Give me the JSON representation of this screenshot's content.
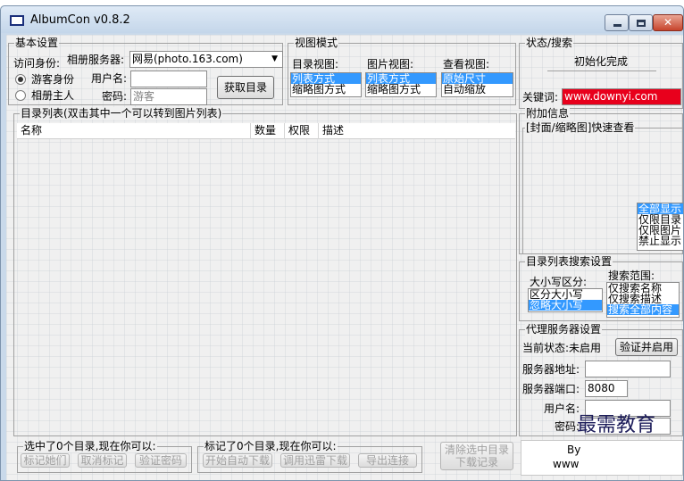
{
  "window": {
    "title": "AlbumCon v0.8.2",
    "close_glyph": "✕"
  },
  "basic": {
    "legend": "基本设置",
    "identity_label": "访问身份:",
    "guest_label": "游客身份",
    "owner_label": "相册主人",
    "server_label": "相册服务器:",
    "server_value": "网易(photo.163.com)",
    "username_label": "用户名:",
    "username_value": "",
    "password_label": "密码:",
    "password_value": "游客",
    "fetch_button": "获取目录"
  },
  "view": {
    "legend": "视图模式",
    "dir_label": "目录视图:",
    "dir_options": [
      "列表方式",
      "缩略图方式"
    ],
    "pic_label": "图片视图:",
    "pic_options": [
      "列表方式",
      "缩略图方式"
    ],
    "see_label": "查看视图:",
    "see_options": [
      "原始尺寸",
      "自动缩放"
    ]
  },
  "status": {
    "legend": "状态/搜索",
    "message": "初始化完成",
    "keyword_label": "关键词:",
    "keyword_value": "www.downyi.com"
  },
  "dirlist": {
    "legend": "目录列表(双击其中一个可以转到图片列表)",
    "columns": [
      "名称",
      "数量",
      "权限",
      "描述"
    ]
  },
  "extra": {
    "legend": "附加信息",
    "quick_legend": "[封面/缩略图]快速查看",
    "filter_options": [
      "全部显示",
      "仅限目录",
      "仅限图片",
      "禁止显示"
    ]
  },
  "search": {
    "legend": "目录列表搜索设置",
    "case_label": "大小写区分:",
    "case_options": [
      "区分大小写",
      "忽略大小写"
    ],
    "scope_label": "搜索范围:",
    "scope_options": [
      "仅搜索名称",
      "仅搜索描述",
      "搜索全部内容"
    ]
  },
  "proxy": {
    "legend": "代理服务器设置",
    "state_label": "当前状态:未启用",
    "verify_button": "验证并启用",
    "addr_label": "服务器地址:",
    "addr_value": "",
    "port_label": "服务器端口:",
    "port_value": "8080",
    "user_label": "用户名:",
    "user_value": "",
    "pwd_label": "密码:",
    "pwd_value": ""
  },
  "bottom": {
    "selected_legend": "选中了0个目录,现在你可以:",
    "mark_button": "标记她们",
    "unmark_button": "取消标记",
    "verify_pwd_button": "验证密码",
    "marked_legend": "标记了0个目录,现在你可以:",
    "auto_download_button": "开始自动下载",
    "thunder_button": "调用迅雷下载",
    "export_button": "导出连接",
    "clear_button_line1": "清除选中目录",
    "clear_button_line2": "下载记录",
    "by_text": "By",
    "www_text": "www",
    "watermark": "最需教育"
  }
}
